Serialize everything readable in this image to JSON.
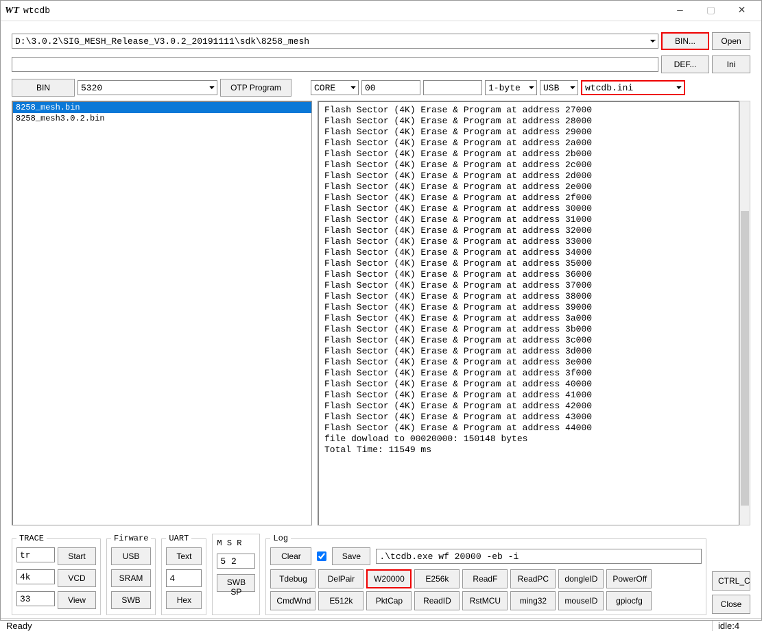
{
  "title": "wtcdb",
  "wt_prefix": "WT",
  "path": "D:\\3.0.2\\SIG_MESH_Release_V3.0.2_20191111\\sdk\\8258_mesh",
  "bin_button": "BIN...",
  "open_button": "Open",
  "def_button": "DEF...",
  "ini_button": "Ini",
  "def_path": "",
  "toolbar": {
    "bin_label": "BIN",
    "bin_select": "5320",
    "otp_program": "OTP Program",
    "core_select": "CORE",
    "addr_value": "00",
    "extra_value": "",
    "byte_select": "1-byte",
    "conn_select": "USB",
    "ini_select": "wtcdb.ini"
  },
  "filelist": {
    "items": [
      "8258_mesh.bin",
      "8258_mesh3.0.2.bin"
    ],
    "selected_index": 0
  },
  "log_lines": [
    "Flash Sector (4K) Erase & Program at address 27000",
    "Flash Sector (4K) Erase & Program at address 28000",
    "Flash Sector (4K) Erase & Program at address 29000",
    "Flash Sector (4K) Erase & Program at address 2a000",
    "Flash Sector (4K) Erase & Program at address 2b000",
    "Flash Sector (4K) Erase & Program at address 2c000",
    "Flash Sector (4K) Erase & Program at address 2d000",
    "Flash Sector (4K) Erase & Program at address 2e000",
    "Flash Sector (4K) Erase & Program at address 2f000",
    "Flash Sector (4K) Erase & Program at address 30000",
    "Flash Sector (4K) Erase & Program at address 31000",
    "Flash Sector (4K) Erase & Program at address 32000",
    "Flash Sector (4K) Erase & Program at address 33000",
    "Flash Sector (4K) Erase & Program at address 34000",
    "Flash Sector (4K) Erase & Program at address 35000",
    "Flash Sector (4K) Erase & Program at address 36000",
    "Flash Sector (4K) Erase & Program at address 37000",
    "Flash Sector (4K) Erase & Program at address 38000",
    "Flash Sector (4K) Erase & Program at address 39000",
    "Flash Sector (4K) Erase & Program at address 3a000",
    "Flash Sector (4K) Erase & Program at address 3b000",
    "Flash Sector (4K) Erase & Program at address 3c000",
    "Flash Sector (4K) Erase & Program at address 3d000",
    "Flash Sector (4K) Erase & Program at address 3e000",
    "Flash Sector (4K) Erase & Program at address 3f000",
    "Flash Sector (4K) Erase & Program at address 40000",
    "Flash Sector (4K) Erase & Program at address 41000",
    "Flash Sector (4K) Erase & Program at address 42000",
    "Flash Sector (4K) Erase & Program at address 43000",
    "Flash Sector (4K) Erase & Program at address 44000",
    "file dowload to 00020000: 150148 bytes",
    "Total Time: 11549 ms"
  ],
  "trace": {
    "legend": "TRACE",
    "tr": "tr",
    "start": "Start",
    "k4": "4k",
    "vcd": "VCD",
    "n33": "33",
    "view": "View"
  },
  "firmware": {
    "legend": "Firware",
    "usb": "USB",
    "sram": "SRAM",
    "swb": "SWB"
  },
  "uart": {
    "legend": "UART",
    "text": "Text",
    "four": "4",
    "hex": "Hex"
  },
  "msr": {
    "hdr": "M  S  R",
    "val": "5 2",
    "swb_sp": "SWB SP"
  },
  "log_toolbar": {
    "legend": "Log",
    "clear": "Clear",
    "save": "Save",
    "cmd": ".\\tcdb.exe wf 20000 -eb -i",
    "buttons": [
      "Tdebug",
      "DelPair",
      "W20000",
      "E256k",
      "ReadF",
      "ReadPC",
      "dongleID",
      "PowerOff",
      "CmdWnd",
      "E512k",
      "PktCap",
      "ReadID",
      "RstMCU",
      "ming32",
      "mouseID",
      "gpiocfg"
    ],
    "highlighted_index": 2
  },
  "side": {
    "ctrl_c": "CTRL_C",
    "close": "Close"
  },
  "status": {
    "ready": "Ready",
    "idle": "idle:4"
  }
}
